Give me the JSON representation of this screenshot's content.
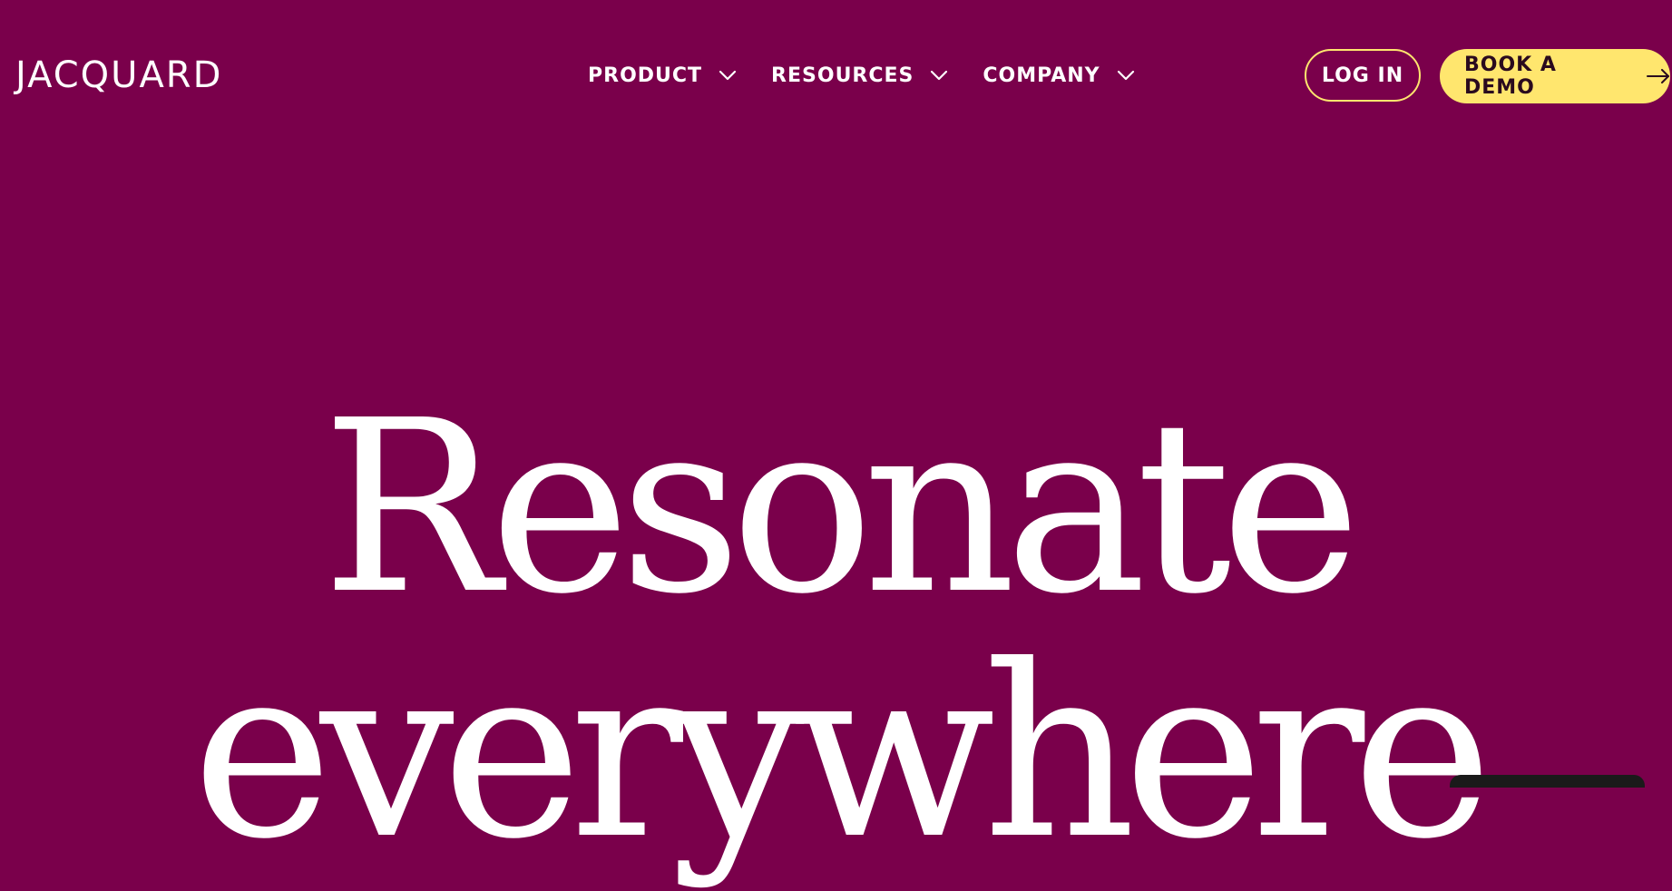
{
  "header": {
    "logo": "JACQUARD",
    "nav": [
      {
        "label": "PRODUCT",
        "icon": "chevron-down-icon"
      },
      {
        "label": "RESOURCES",
        "icon": "chevron-down-icon"
      },
      {
        "label": "COMPANY",
        "icon": "chevron-down-icon"
      }
    ],
    "login_label": "LOG IN",
    "demo_label": "BOOK A DEMO",
    "demo_icon": "arrow-right-icon"
  },
  "hero": {
    "line1": "Resonate",
    "line2": "everywhere"
  },
  "colors": {
    "background": "#7a004b",
    "accent": "#ffe66e",
    "text": "#ffffff"
  }
}
